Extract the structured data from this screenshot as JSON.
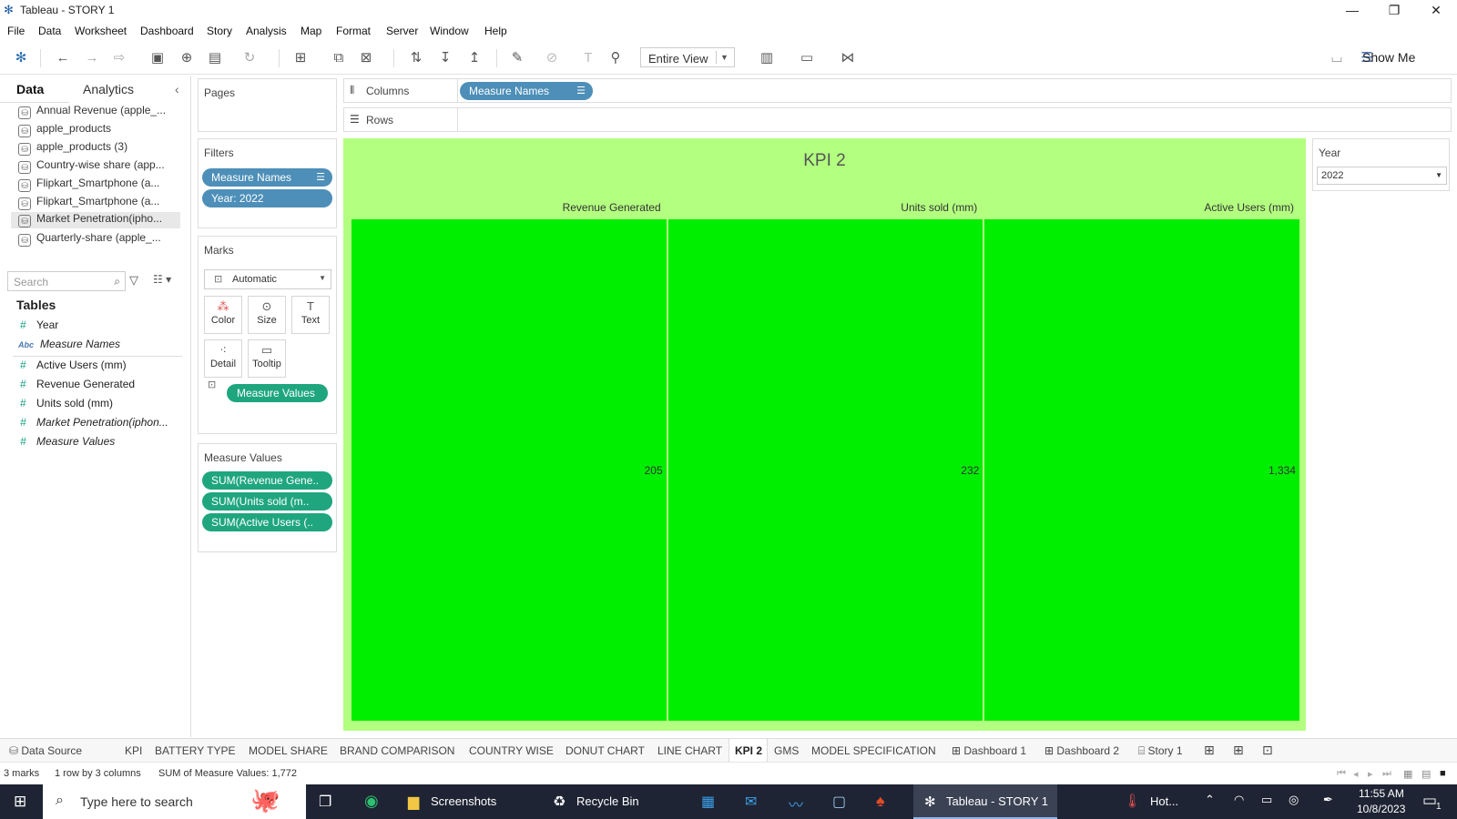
{
  "window": {
    "title": "Tableau - STORY 1"
  },
  "menu": [
    "File",
    "Data",
    "Worksheet",
    "Dashboard",
    "Story",
    "Analysis",
    "Map",
    "Format",
    "Server",
    "Window",
    "Help"
  ],
  "toolbar": {
    "view_select": "Entire View",
    "show_me": "Show Me"
  },
  "left_pane": {
    "tabs": [
      "Data",
      "Analytics"
    ],
    "data_sources": [
      "Annual Revenue (apple_...",
      "apple_products",
      "apple_products (3)",
      "Country-wise share (app...",
      "Flipkart_Smartphone (a...",
      "Flipkart_Smartphone (a...",
      "Market Penetration(ipho...",
      "Quarterly-share (apple_..."
    ],
    "search_placeholder": "Search",
    "tables_heading": "Tables",
    "fields": [
      {
        "type": "#",
        "name": "Year"
      },
      {
        "type": "Abc",
        "name": "Measure Names"
      },
      {
        "type": "#",
        "name": "Active Users (mm)"
      },
      {
        "type": "#",
        "name": "Revenue Generated"
      },
      {
        "type": "#",
        "name": "Units sold (mm)"
      },
      {
        "type": "#",
        "name": "Market Penetration(iphon..."
      },
      {
        "type": "#",
        "name": "Measure Values"
      }
    ]
  },
  "shelves": {
    "pages_label": "Pages",
    "columns_label": "Columns",
    "rows_label": "Rows",
    "columns_pill": "Measure Names",
    "filters_label": "Filters",
    "filters": [
      "Measure Names",
      "Year: 2022"
    ],
    "marks_label": "Marks",
    "mark_type": "Automatic",
    "mark_buttons": [
      "Color",
      "Size",
      "Text",
      "Detail",
      "Tooltip"
    ],
    "marks_pill": "Measure Values",
    "measure_values_label": "Measure Values",
    "measure_values": [
      "SUM(Revenue Gene..",
      "SUM(Units sold (m..",
      "SUM(Active Users (.."
    ]
  },
  "viz": {
    "title": "KPI 2",
    "background_color": "#b3ff80",
    "cell_color": "#00ee00"
  },
  "chart_data": {
    "type": "table",
    "title": "KPI 2",
    "categories": [
      "Revenue Generated",
      "Units sold (mm)",
      "Active Users (mm)"
    ],
    "values": [
      205,
      232,
      1334
    ],
    "value_labels": [
      "205",
      "232",
      "1,334"
    ]
  },
  "year_filter": {
    "label": "Year",
    "value": "2022"
  },
  "sheet_tabs": [
    "Data Source",
    "KPI",
    "BATTERY TYPE",
    "MODEL SHARE",
    "BRAND COMPARISON",
    "COUNTRY WISE",
    "DONUT CHART",
    "LINE CHART",
    "KPI 2",
    "GMS",
    "MODEL SPECIFICATION",
    "Dashboard 1",
    "Dashboard 2",
    "Story 1"
  ],
  "active_tab": "KPI 2",
  "status": {
    "marks": "3 marks",
    "layout": "1 row by 3 columns",
    "sum": "SUM of Measure Values: 1,772"
  },
  "taskbar": {
    "search_placeholder": "Type here to search",
    "apps": [
      "Screenshots",
      "Recycle Bin",
      "Tableau - STORY 1"
    ],
    "weather": "Hot...",
    "time": "11:55 AM",
    "date": "10/8/2023",
    "notifications": "1"
  }
}
